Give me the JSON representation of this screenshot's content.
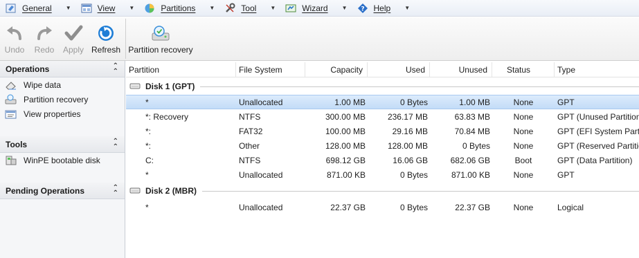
{
  "menu": {
    "items": [
      {
        "label": "General",
        "icon": "general-icon"
      },
      {
        "label": "View",
        "icon": "view-icon"
      },
      {
        "label": "Partitions",
        "icon": "partitions-icon"
      },
      {
        "label": "Tool",
        "icon": "tool-icon"
      },
      {
        "label": "Wizard",
        "icon": "wizard-icon"
      },
      {
        "label": "Help",
        "icon": "help-icon"
      }
    ]
  },
  "toolbar": {
    "undo": "Undo",
    "redo": "Redo",
    "apply": "Apply",
    "refresh": "Refresh",
    "partition_recovery": "Partition recovery"
  },
  "sidebar": {
    "operations": {
      "title": "Operations",
      "items": [
        "Wipe data",
        "Partition recovery",
        "View properties"
      ]
    },
    "tools": {
      "title": "Tools",
      "items": [
        "WinPE bootable disk"
      ]
    },
    "pending": {
      "title": "Pending Operations"
    }
  },
  "table": {
    "columns": [
      "Partition",
      "File System",
      "Capacity",
      "Used",
      "Unused",
      "Status",
      "Type"
    ],
    "disks": [
      {
        "label": "Disk 1 (GPT)",
        "rows": [
          [
            "*",
            "Unallocated",
            "1.00 MB",
            "0 Bytes",
            "1.00 MB",
            "None",
            "GPT"
          ],
          [
            "*: Recovery",
            "NTFS",
            "300.00 MB",
            "236.17 MB",
            "63.83 MB",
            "None",
            "GPT (Unused Partition)"
          ],
          [
            "*:",
            "FAT32",
            "100.00 MB",
            "29.16 MB",
            "70.84 MB",
            "None",
            "GPT (EFI System Partition)"
          ],
          [
            "*:",
            "Other",
            "128.00 MB",
            "128.00 MB",
            "0 Bytes",
            "None",
            "GPT (Reserved Partition)"
          ],
          [
            "C:",
            "NTFS",
            "698.12 GB",
            "16.06 GB",
            "682.06 GB",
            "Boot",
            "GPT (Data Partition)"
          ],
          [
            "*",
            "Unallocated",
            "871.00 KB",
            "0 Bytes",
            "871.00 KB",
            "None",
            "GPT"
          ]
        ]
      },
      {
        "label": "Disk 2 (MBR)",
        "rows": [
          [
            "*",
            "Unallocated",
            "22.37 GB",
            "0 Bytes",
            "22.37 GB",
            "None",
            "Logical"
          ]
        ]
      }
    ]
  },
  "colors": {
    "selected_row": "#c9e0f8",
    "accent_blue": "#2a7bd1"
  }
}
